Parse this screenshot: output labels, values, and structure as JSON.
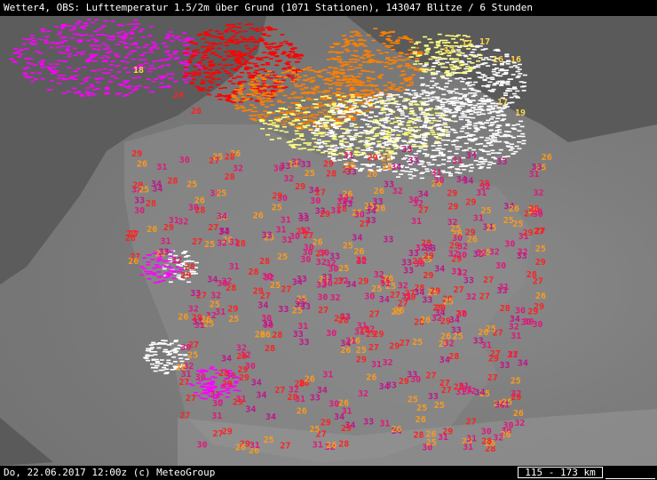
{
  "title": "Wetter4, OBS: Lufttemperatur 1.5/2m über Grund (1071 Stationen), 143047 Blitze / 6 Stunden",
  "footer": {
    "timestamp": "Do, 22.06.2017 12:00z (c) MeteoGroup",
    "scale": "115 - 173 km"
  },
  "colors": {
    "sea": "#5a5a5a",
    "land": "#808080",
    "temp_hot": "#e0177a",
    "temp_very_hot": "#c0138a",
    "temp_warm": "#ff2020",
    "temp_mild": "#ff9a1a",
    "temp_cool": "#ffd54a",
    "lightning_red": "#ff0000",
    "lightning_orange": "#ff8000",
    "lightning_yellow": "#ffff80",
    "lightning_white": "#ffffff",
    "lightning_magenta": "#ff00ff"
  },
  "legend_note": "Blitze / 6 Stunden"
}
